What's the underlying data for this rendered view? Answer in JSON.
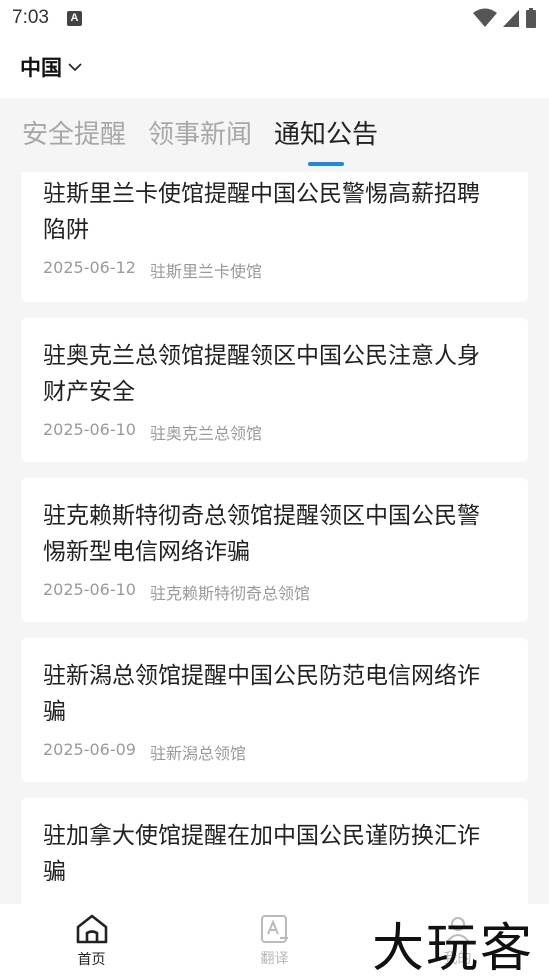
{
  "status_bar": {
    "time": "7:03",
    "notification_icon": "A"
  },
  "header": {
    "region": "中国"
  },
  "tabs": [
    {
      "label": "安全提醒",
      "active": false
    },
    {
      "label": "领事新闻",
      "active": false
    },
    {
      "label": "通知公告",
      "active": true
    }
  ],
  "cards": [
    {
      "title_lines": [
        "驻斯里兰卡使馆提醒中国公民警惕高薪招聘",
        "陷阱"
      ],
      "date": "2025-06-12",
      "source": "驻斯里兰卡使馆"
    },
    {
      "title_lines": [
        "驻奥克兰总领馆提醒领区中国公民注意人身",
        "财产安全"
      ],
      "date": "2025-06-10",
      "source": "驻奥克兰总领馆"
    },
    {
      "title_lines": [
        "驻克赖斯特彻奇总领馆提醒领区中国公民警",
        "惕新型电信网络诈骗"
      ],
      "date": "2025-06-10",
      "source": "驻克赖斯特彻奇总领馆"
    },
    {
      "title_lines": [
        "驻新潟总领馆提醒中国公民防范电信网络诈",
        "骗"
      ],
      "date": "2025-06-09",
      "source": "驻新潟总领馆"
    },
    {
      "title_lines": [
        "驻加拿大使馆提醒在加中国公民谨防换汇诈",
        "骗"
      ],
      "date": "",
      "source": ""
    }
  ],
  "bottom_nav": [
    {
      "label": "首页",
      "icon": "home-icon",
      "active": true
    },
    {
      "label": "翻译",
      "icon": "translate-icon",
      "active": false
    },
    {
      "label": "我的",
      "icon": "profile-icon",
      "active": false
    }
  ],
  "watermark": "大玩客",
  "colors": {
    "accent": "#1e88e5",
    "background": "#f5f5f5",
    "card": "#ffffff",
    "muted_text": "#9a9a9a",
    "inactive_tab": "#a8a8a8"
  }
}
